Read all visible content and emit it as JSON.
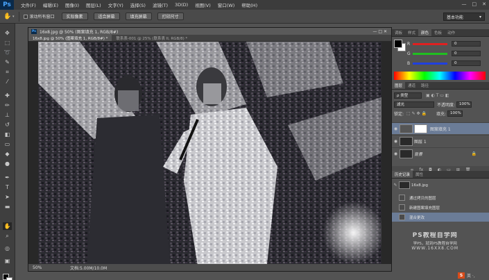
{
  "app": {
    "logo": "Ps"
  },
  "menu": [
    "文件(F)",
    "编辑(E)",
    "图像(I)",
    "图层(L)",
    "文字(Y)",
    "选择(S)",
    "滤镜(T)",
    "3D(D)",
    "视图(V)",
    "窗口(W)",
    "帮助(H)"
  ],
  "window_controls": [
    "—",
    "□",
    "✕"
  ],
  "options_bar": {
    "scroll_all_label": "滚动所有窗口",
    "buttons": [
      "实际像素",
      "适合屏幕",
      "填充屏幕",
      "打印尺寸"
    ],
    "workspace": "基本功能"
  },
  "document": {
    "title": "16x8.jpg @ 50% (图案填充 1, RGB/8#)",
    "tabs": [
      {
        "label": "16x8.jpg @ 50% (图案填充 1, RGB/8#) *",
        "active": true
      },
      {
        "label": "联系表-001 @ 25% (联系表 II, RGB/8) *",
        "active": false
      }
    ],
    "zoom": "50%",
    "doc_info": "文档:5.00M/10.0M"
  },
  "color_panel": {
    "tabs": [
      "调板",
      "样式",
      "颜色",
      "色板",
      "动作"
    ],
    "active_tab": "颜色",
    "channels": [
      {
        "name": "R",
        "value": "0",
        "color": "#e02020"
      },
      {
        "name": "G",
        "value": "0",
        "color": "#20c020"
      },
      {
        "name": "B",
        "value": "0",
        "color": "#2040e0"
      }
    ]
  },
  "layers_panel": {
    "tabs": [
      "图层",
      "通道",
      "路径"
    ],
    "active_tab": "图层",
    "filter_label": "ρ 类型",
    "blend_mode": "滤光",
    "opacity_label": "不透明度:",
    "opacity_value": "100%",
    "lock_label": "锁定:",
    "fill_label": "填充:",
    "fill_value": "100%",
    "layers": [
      {
        "name": "图案填充 1",
        "selected": true,
        "locked": false
      },
      {
        "name": "图层 1",
        "selected": false,
        "locked": false
      },
      {
        "name": "背景",
        "selected": false,
        "locked": true
      }
    ]
  },
  "history_panel": {
    "tabs": [
      "历史记录",
      "属性"
    ],
    "active_tab": "历史记录",
    "snapshot": "16x8.jpg",
    "items": [
      {
        "label": "通过拷贝的图层",
        "selected": false
      },
      {
        "label": "新建图案填充图层",
        "selected": false
      },
      {
        "label": "混合更改",
        "selected": true
      }
    ]
  },
  "watermark": {
    "title": "PS教程自学网",
    "subtitle": "学PS，就到PS教程自学网",
    "url": "WWW.16XX8.COM"
  },
  "tray": {
    "icon_text": "S",
    "text": "英 ·,"
  }
}
